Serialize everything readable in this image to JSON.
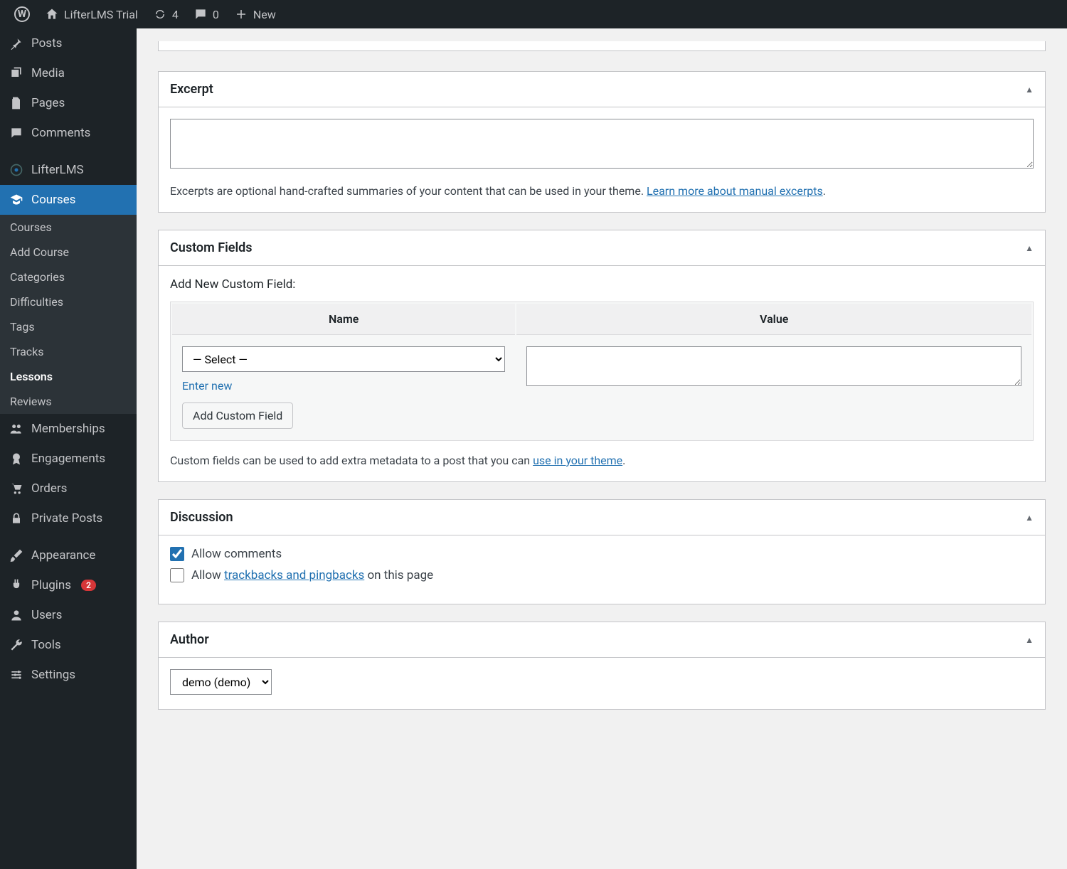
{
  "adminBar": {
    "siteName": "LifterLMS Trial",
    "updateCount": "4",
    "commentCount": "0",
    "newLabel": "New"
  },
  "sidebar": {
    "posts": "Posts",
    "media": "Media",
    "pages": "Pages",
    "comments": "Comments",
    "lifterlms": "LifterLMS",
    "courses": "Courses",
    "sub": {
      "courses": "Courses",
      "addCourse": "Add Course",
      "categories": "Categories",
      "difficulties": "Difficulties",
      "tags": "Tags",
      "tracks": "Tracks",
      "lessons": "Lessons",
      "reviews": "Reviews"
    },
    "memberships": "Memberships",
    "engagements": "Engagements",
    "orders": "Orders",
    "privatePosts": "Private Posts",
    "appearance": "Appearance",
    "plugins": "Plugins",
    "pluginsBadge": "2",
    "users": "Users",
    "tools": "Tools",
    "settings": "Settings"
  },
  "excerpt": {
    "title": "Excerpt",
    "value": "",
    "help1": "Excerpts are optional hand-crafted summaries of your content that can be used in your theme. ",
    "helpLink": "Learn more about manual excerpts",
    "helpEnd": "."
  },
  "customFields": {
    "title": "Custom Fields",
    "addLabel": "Add New Custom Field:",
    "nameHeader": "Name",
    "valueHeader": "Value",
    "selectPlaceholder": "— Select —",
    "enterNew": "Enter new",
    "addButton": "Add Custom Field",
    "help1": "Custom fields can be used to add extra metadata to a post that you can ",
    "helpLink": "use in your theme",
    "helpEnd": "."
  },
  "discussion": {
    "title": "Discussion",
    "allowComments": "Allow comments",
    "allowCommentsChecked": true,
    "allowTrackbacksPre": "Allow ",
    "allowTrackbacksLink": "trackbacks and pingbacks",
    "allowTrackbacksPost": " on this page",
    "allowTrackbacksChecked": false
  },
  "author": {
    "title": "Author",
    "selected": "demo (demo)"
  }
}
